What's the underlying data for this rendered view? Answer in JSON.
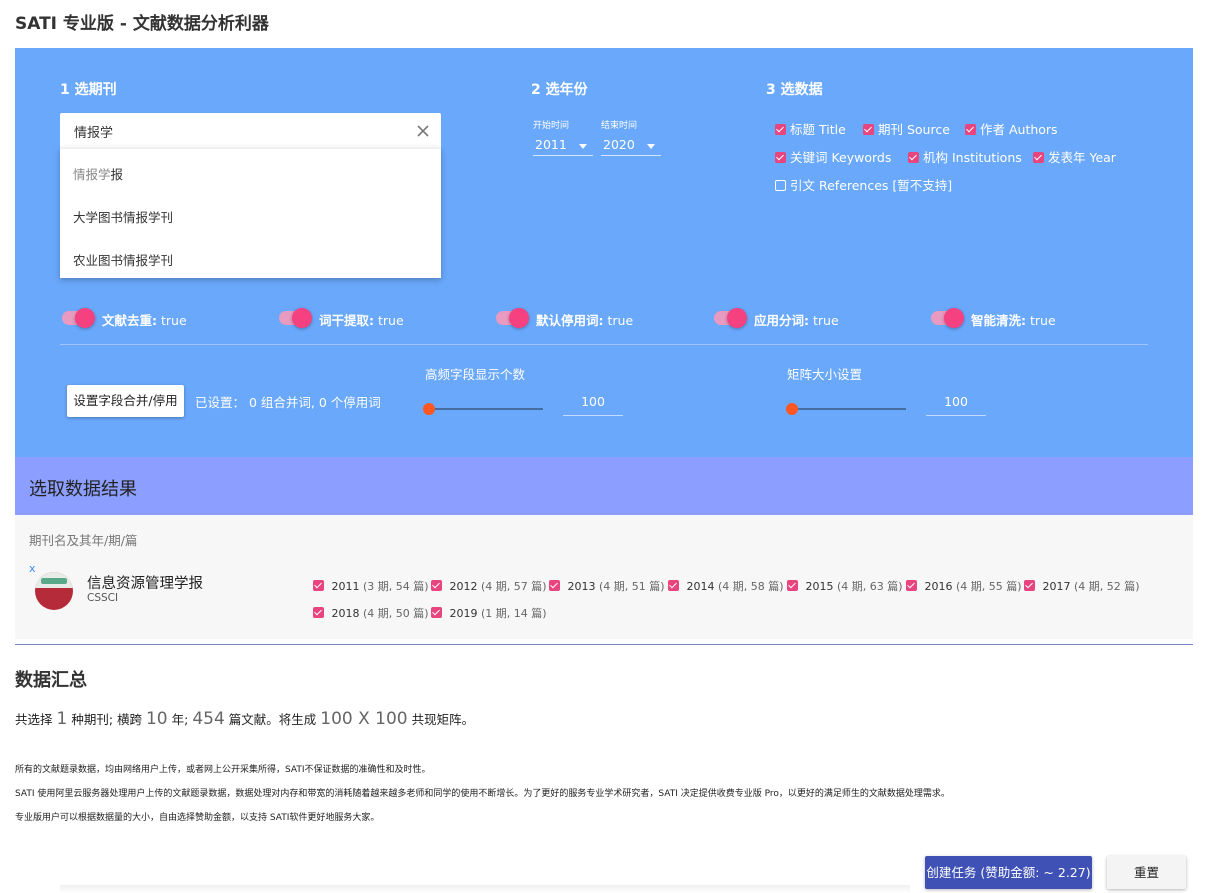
{
  "app": {
    "title": "SATI 专业版 - 文献数据分析利器"
  },
  "step1": {
    "title": "1 选期刊",
    "search_value": "情报学",
    "suggestions": [
      {
        "match": "情报学",
        "rest": "报"
      },
      {
        "text": "大学图书情报学刊"
      },
      {
        "text": "农业图书情报学刊"
      }
    ]
  },
  "step2": {
    "title": "2 选年份",
    "start_label": "开始时间",
    "start_value": "2011",
    "end_label": "结束时间",
    "end_value": "2020"
  },
  "step3": {
    "title": "3 选数据",
    "fields": [
      {
        "label": "标题 Title",
        "checked": true
      },
      {
        "label": "期刊 Source",
        "checked": true
      },
      {
        "label": "作者 Authors",
        "checked": true
      },
      {
        "label": "关键词 Keywords",
        "checked": true
      },
      {
        "label": "机构 Institutions",
        "checked": true
      },
      {
        "label": "发表年 Year",
        "checked": true
      },
      {
        "label": "引文 References [暂不支持]",
        "checked": false
      }
    ]
  },
  "options": [
    {
      "label": "文献去重:",
      "value": "true"
    },
    {
      "label": "词干提取:",
      "value": "true"
    },
    {
      "label": "默认停用词:",
      "value": "true"
    },
    {
      "label": "应用分词:",
      "value": "true"
    },
    {
      "label": "智能清洗:",
      "value": "true"
    }
  ],
  "settings": {
    "merge_button": "设置字段合并/停用",
    "merge_status": "已设置： 0 组合并词, 0 个停用词",
    "freq_label": "高频字段显示个数",
    "freq_value": "100",
    "matrix_label": "矩阵大小设置",
    "matrix_value": "100"
  },
  "results": {
    "title": "选取数据结果",
    "header": "期刊名及其年/期/篇",
    "remove": "x",
    "journal": {
      "name": "信息资源管理学报",
      "tag": "CSSCI",
      "years": [
        {
          "year": "2011",
          "meta": "(3 期, 54 篇)"
        },
        {
          "year": "2012",
          "meta": "(4 期, 57 篇)"
        },
        {
          "year": "2013",
          "meta": "(4 期, 51 篇)"
        },
        {
          "year": "2014",
          "meta": "(4 期, 58 篇)"
        },
        {
          "year": "2015",
          "meta": "(4 期, 63 篇)"
        },
        {
          "year": "2016",
          "meta": "(4 期, 55 篇)"
        },
        {
          "year": "2017",
          "meta": "(4 期, 52 篇)"
        },
        {
          "year": "2018",
          "meta": "(4 期, 50 篇)"
        },
        {
          "year": "2019",
          "meta": "(1 期, 14 篇)"
        }
      ]
    }
  },
  "summary": {
    "title": "数据汇总",
    "p1": "共选择",
    "journals": "1",
    "p2": "种期刊; 横跨",
    "years": "10",
    "p3": "年;",
    "docs": "454",
    "p4": "篇文献。将生成",
    "matrix": "100 X 100",
    "p5": "共现矩阵。",
    "notes": [
      "所有的文献题录数据，均由网络用户上传，或者网上公开采集所得，SATI不保证数据的准确性和及时性。",
      "SATI 使用阿里云服务器处理用户上传的文献题录数据，数据处理对内存和带宽的消耗随着越来越多老师和同学的使用不断增长。为了更好的服务专业学术研究者，SATI 决定提供收费专业版 Pro，以更好的满足师生的文献数据处理需求。",
      "专业版用户可以根据数据量的大小，自由选择赞助金额，以支持 SATI软件更好地服务大家。"
    ]
  },
  "actions": {
    "create": "创建任务 (赞助金额: ~ 2.27)",
    "reset": "重置"
  }
}
